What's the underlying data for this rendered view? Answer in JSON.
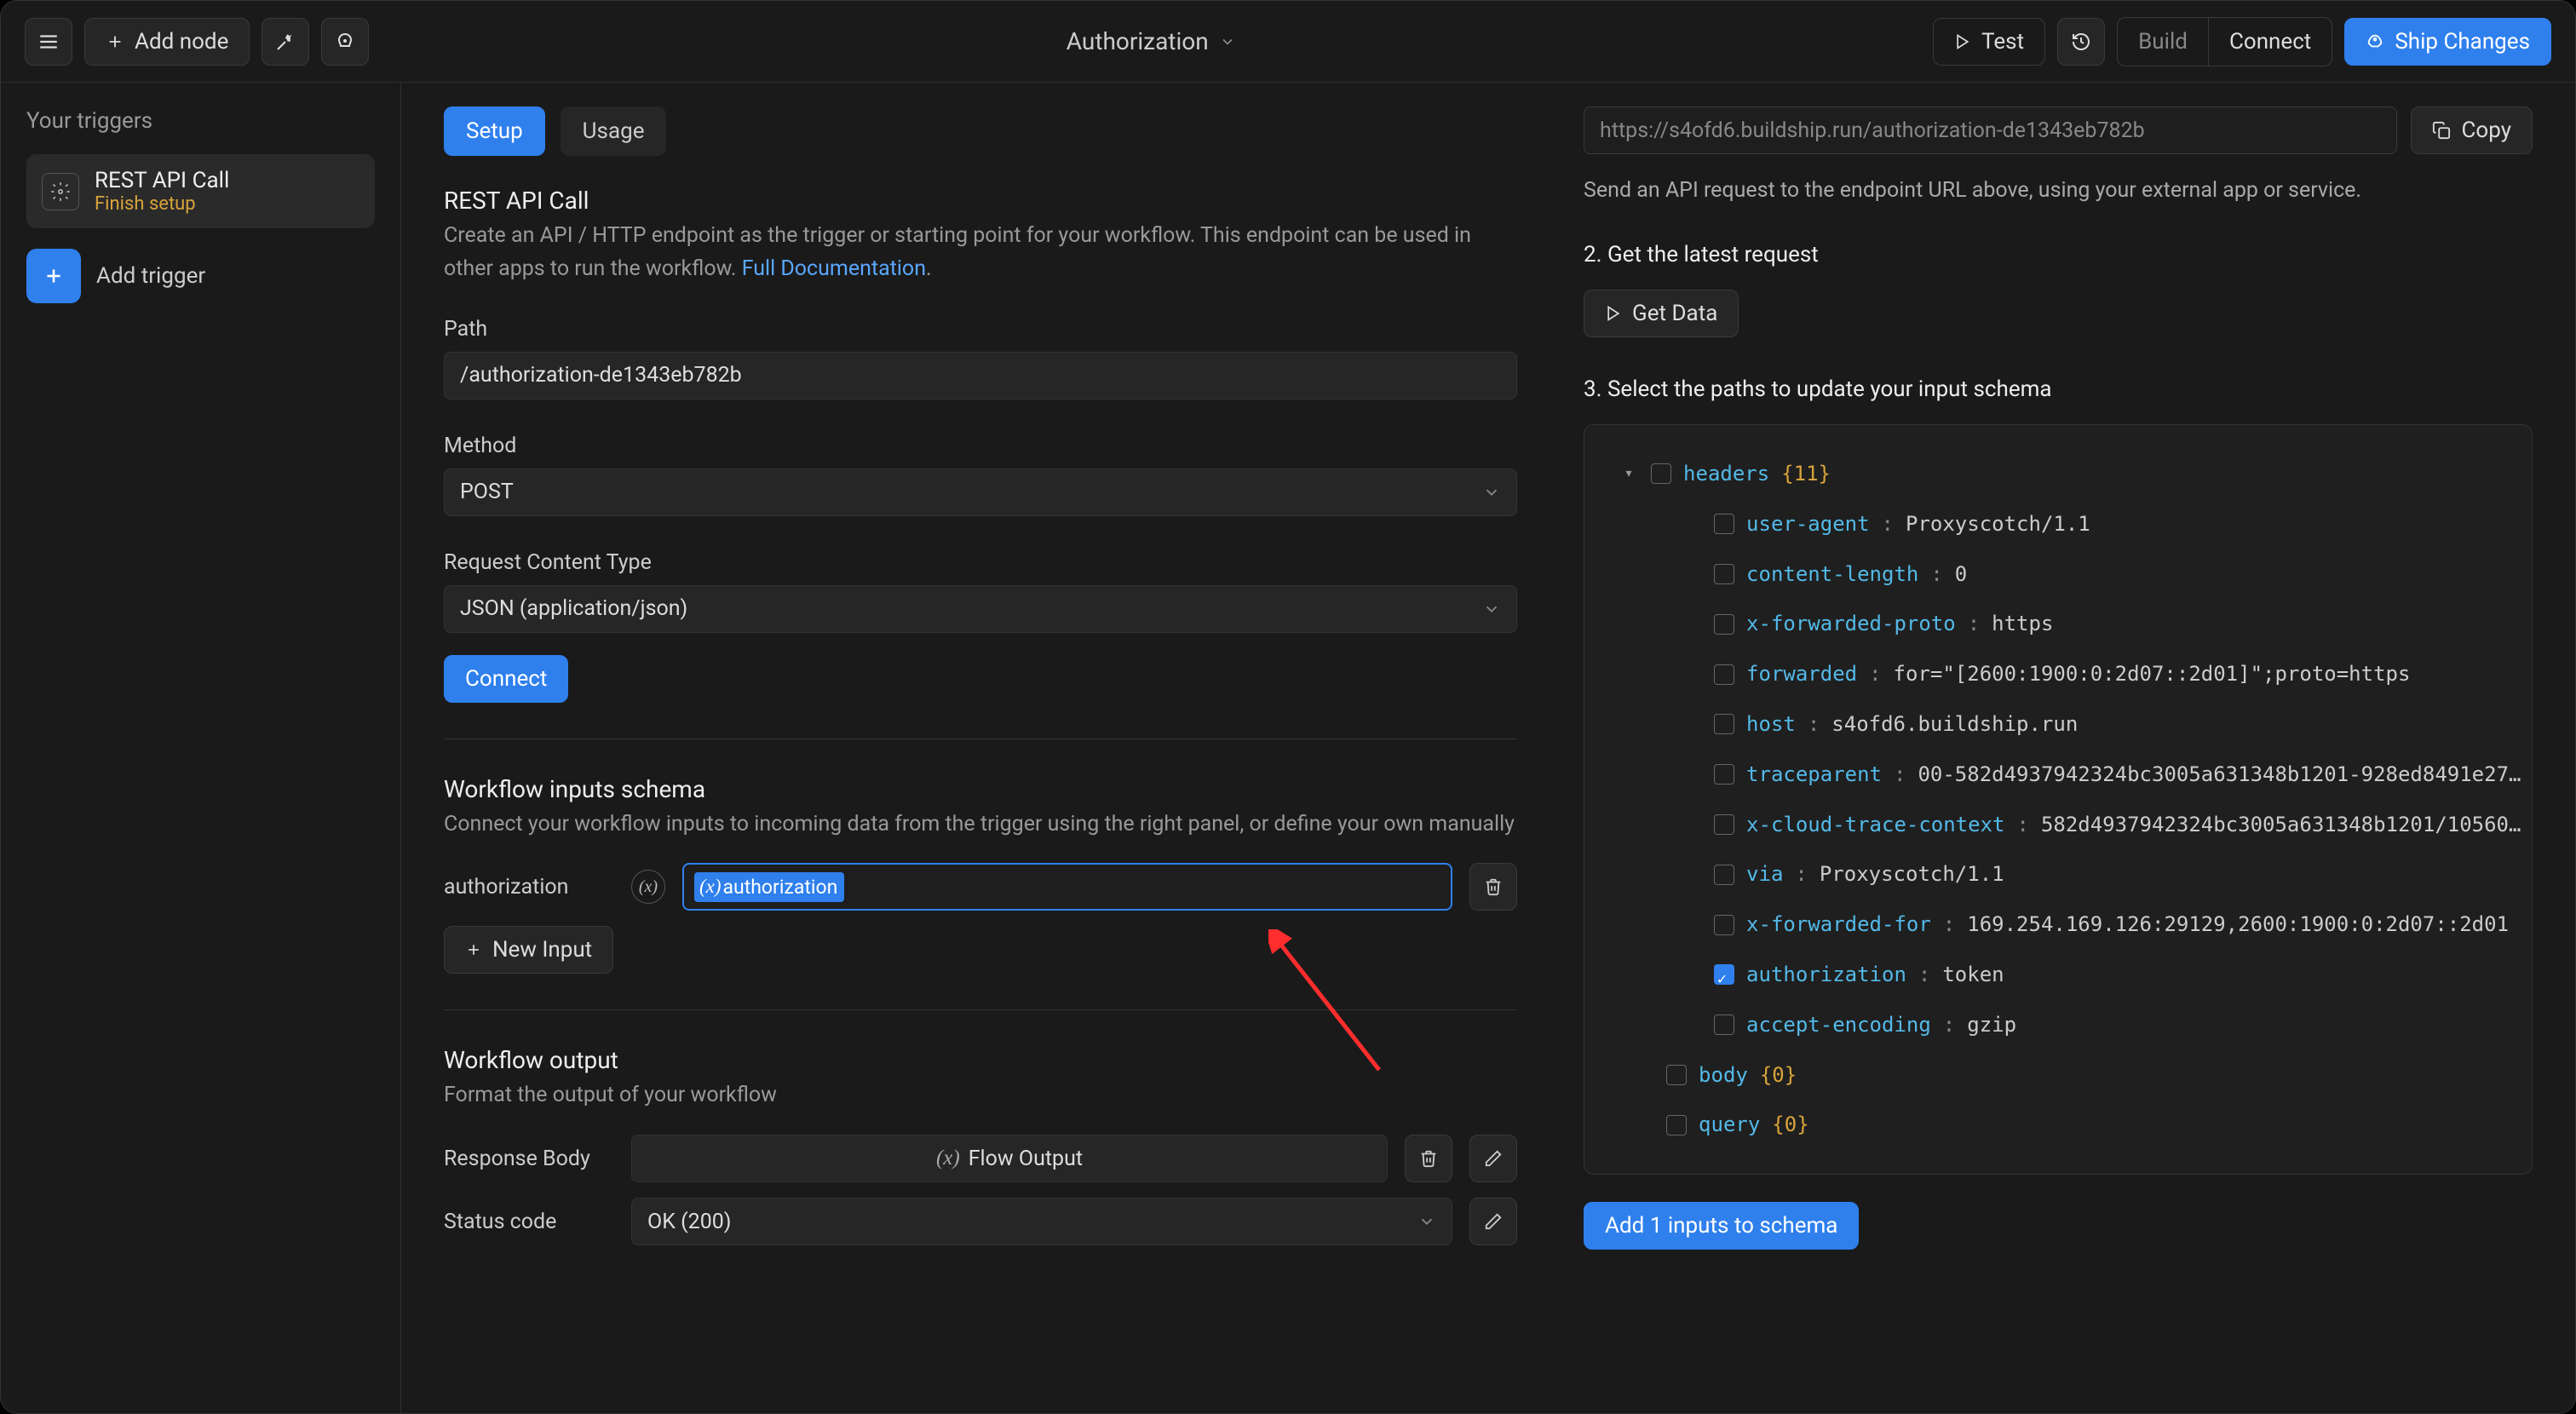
{
  "topbar": {
    "add_node": "Add node",
    "title": "Authorization",
    "test": "Test",
    "build": "Build",
    "connect": "Connect",
    "ship": "Ship Changes"
  },
  "sidebar": {
    "heading": "Your triggers",
    "trigger": {
      "title": "REST API Call",
      "subtitle": "Finish setup"
    },
    "add_trigger": "Add trigger"
  },
  "tabs": {
    "setup": "Setup",
    "usage": "Usage"
  },
  "rest": {
    "title": "REST API Call",
    "desc_a": "Create an API / HTTP endpoint as the trigger or starting point for your workflow. This endpoint can be used in other apps to run the workflow. ",
    "desc_link": "Full Documentation",
    "desc_b": ".",
    "path_label": "Path",
    "path_value": "/authorization-de1343eb782b",
    "method_label": "Method",
    "method_value": "POST",
    "rct_label": "Request Content Type",
    "rct_value": "JSON (application/json)",
    "connect_btn": "Connect"
  },
  "schema": {
    "title": "Workflow inputs schema",
    "desc": "Connect your workflow inputs to incoming data from the trigger using the right panel, or define your own manually",
    "field_label": "authorization",
    "pill_text": "authorization",
    "new_input": "New Input"
  },
  "output": {
    "title": "Workflow output",
    "desc": "Format the output of your workflow",
    "response_body": "Response Body",
    "flow_output": "Flow Output",
    "status_code": "Status code",
    "status_value": "OK (200)"
  },
  "right": {
    "url": "https://s4ofd6.buildship.run/authorization-de1343eb782b",
    "copy": "Copy",
    "send_desc": "Send an API request to the endpoint URL above, using your external app or service.",
    "step2": "2. Get the latest request",
    "get_data": "Get Data",
    "step3": "3. Select the paths to update your input schema",
    "add_inputs": "Add 1 inputs to schema",
    "tree": {
      "headers_key": "headers",
      "headers_meta": "{11}",
      "rows": [
        {
          "k": "user-agent",
          "v": "Proxyscotch/1.1",
          "checked": false
        },
        {
          "k": "content-length",
          "v": "0",
          "checked": false
        },
        {
          "k": "x-forwarded-proto",
          "v": "https",
          "checked": false
        },
        {
          "k": "forwarded",
          "v": "for=\"[2600:1900:0:2d07::2d01]\";proto=https",
          "checked": false
        },
        {
          "k": "host",
          "v": "s4ofd6.buildship.run",
          "checked": false
        },
        {
          "k": "traceparent",
          "v": "00-582d4937942324bc3005a631348b1201-928ed8491e27…",
          "checked": false
        },
        {
          "k": "x-cloud-trace-context",
          "v": "582d4937942324bc3005a631348b1201/10560…",
          "checked": false
        },
        {
          "k": "via",
          "v": "Proxyscotch/1.1",
          "checked": false
        },
        {
          "k": "x-forwarded-for",
          "v": "169.254.169.126:29129,2600:1900:0:2d07::2d01",
          "checked": false
        },
        {
          "k": "authorization",
          "v": "token",
          "checked": true
        },
        {
          "k": "accept-encoding",
          "v": "gzip",
          "checked": false
        }
      ],
      "body_key": "body",
      "body_meta": "{0}",
      "query_key": "query",
      "query_meta": "{0}"
    }
  }
}
